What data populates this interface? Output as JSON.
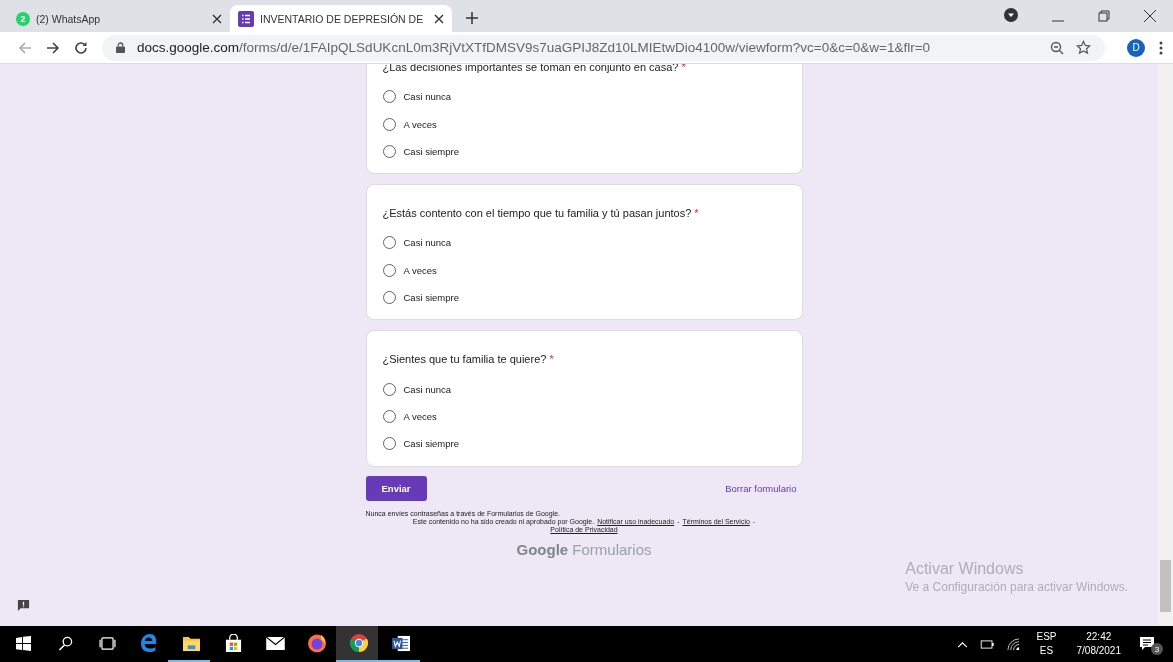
{
  "browser": {
    "tabs": [
      {
        "kind": "whatsapp",
        "badge": "2",
        "title": "(2) WhatsApp",
        "selected": false
      },
      {
        "kind": "forms",
        "title": "INVENTARIO DE DEPRESIÓN DE",
        "selected": true
      }
    ],
    "url_host": "docs.google.com",
    "url_path": "/forms/d/e/1FAIpQLSdUKcnL0m3RjVtXTfDMSV9s7uaGPIJ8Zd10LMIEtwDio4100w/viewform?vc=0&c=0&w=1&flr=0",
    "profile": "D"
  },
  "questions": [
    {
      "title": "¿Las decisiones importantes se toman en conjunto en casa?",
      "required": true,
      "options": [
        {
          "label": "Casi nunca",
          "selected": false
        },
        {
          "label": "A veces",
          "selected": false
        },
        {
          "label": "Casi siempre",
          "selected": false
        }
      ]
    },
    {
      "title": "¿Estás contento con el tiempo que tu familia y tú pasan juntos?",
      "required": true,
      "options": [
        {
          "label": "Casi nunca",
          "selected": false
        },
        {
          "label": "A veces",
          "selected": false
        },
        {
          "label": "Casi siempre",
          "selected": false
        }
      ]
    },
    {
      "title": "¿Sientes que tu familia te quiere?",
      "required": true,
      "options": [
        {
          "label": "Casi nunca",
          "selected": false
        },
        {
          "label": "A veces",
          "selected": false
        },
        {
          "label": "Casi siempre",
          "selected": false
        }
      ]
    }
  ],
  "required_mark": "*",
  "submit": "Enviar",
  "clear": "Borrar formulario",
  "password_notice": "Nunca envíes contraseñas a través de Formularios de Google.",
  "disclaimer": "Este contenido no ha sido creado ni aprobado por Google.",
  "links": [
    "Notificar uso inadecuado",
    "Términos del Servicio",
    "Política de Privacidad"
  ],
  "separator": "-",
  "brand": {
    "google": "Google",
    "product": "Formularios"
  },
  "activation": {
    "title": "Activar Windows",
    "text": "Ve a Configuración para activar Windows."
  },
  "taskbar": {
    "apps": [
      {
        "kind": "start",
        "running": false,
        "active": false
      },
      {
        "kind": "search",
        "running": false,
        "active": false
      },
      {
        "kind": "taskview",
        "running": false,
        "active": false
      },
      {
        "kind": "edge",
        "running": false,
        "active": false
      },
      {
        "kind": "explorer",
        "running": true,
        "active": false
      },
      {
        "kind": "store",
        "running": false,
        "active": false
      },
      {
        "kind": "mail",
        "running": false,
        "active": false
      },
      {
        "kind": "firefox",
        "running": false,
        "active": false
      },
      {
        "kind": "chrome",
        "running": true,
        "active": true
      },
      {
        "kind": "word",
        "running": true,
        "active": false
      }
    ],
    "lang_top": "ESP",
    "lang_bottom": "ES",
    "time": "22:42",
    "date": "7/08/2021",
    "notifications": "3"
  }
}
